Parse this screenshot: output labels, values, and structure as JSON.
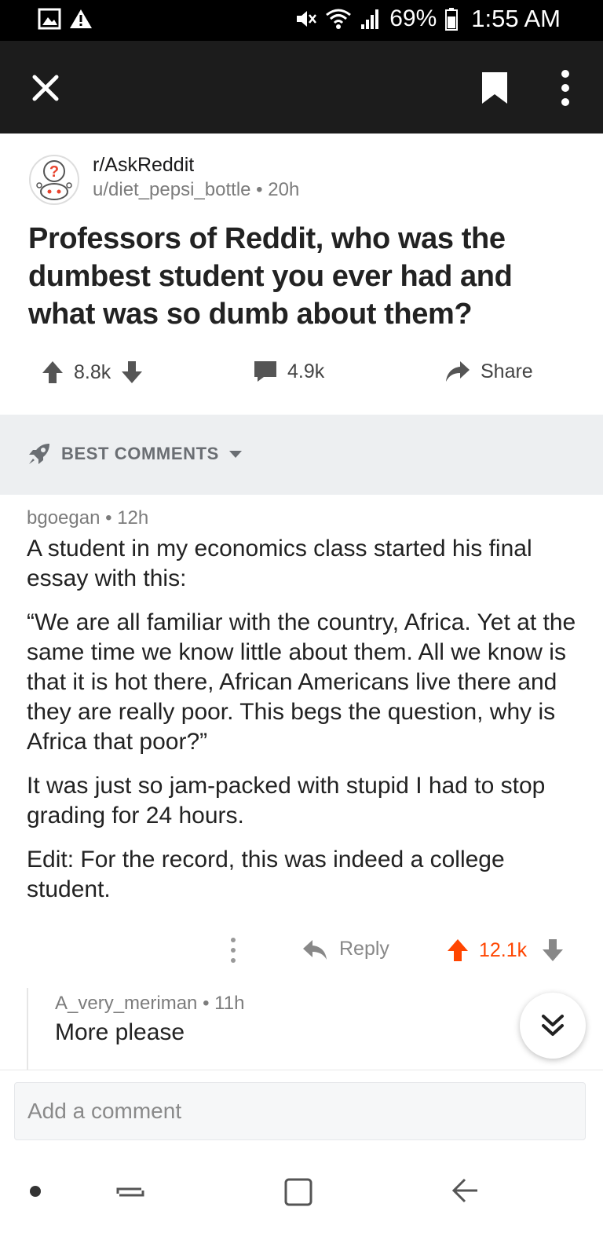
{
  "status_bar": {
    "battery": "69%",
    "time": "1:55 AM",
    "icons": [
      "image-icon",
      "warning-icon",
      "mute-icon",
      "wifi-icon",
      "signal-icon",
      "battery-icon"
    ]
  },
  "app_bar": {
    "icons": [
      "close-icon",
      "bookmark-icon",
      "more-vertical-icon"
    ]
  },
  "post": {
    "subreddit": "r/AskReddit",
    "author": "u/diet_pepsi_bottle",
    "age": "20h",
    "title": "Professors of Reddit, who was the dumbest student you ever had and what was so dumb about them?",
    "score": "8.8k",
    "comments": "4.9k",
    "share_label": "Share"
  },
  "sort": {
    "label": "BEST COMMENTS"
  },
  "comment": {
    "author": "bgoegan",
    "age": "12h",
    "paragraphs": [
      "A student in my economics class started his final essay with this:",
      "“We are all familiar with the country, Africa. Yet at the same time we know little about them. All we know is that it is hot there, African Americans live there and they are really poor. This begs the question, why is Africa that poor?”",
      "It was just so jam-packed with stupid I had to stop grading for 24 hours.",
      "Edit: For the record, this was indeed a college student."
    ],
    "reply_label": "Reply",
    "score": "12.1k",
    "accent_color": "#ff4500"
  },
  "child_comment": {
    "author": "A_very_meriman",
    "age": "11h",
    "text": "More please"
  },
  "composer": {
    "placeholder": "Add a comment"
  }
}
